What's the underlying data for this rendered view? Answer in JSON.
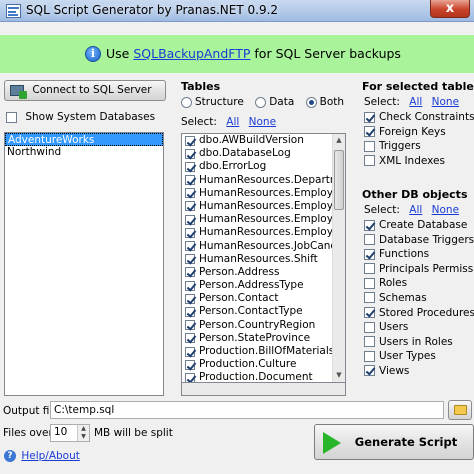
{
  "window": {
    "title": "SQL Script Generator by Pranas.NET 0.9.2",
    "close_glyph": "x"
  },
  "banner": {
    "prefix": "Use ",
    "link": "SQLBackupAndFTP",
    "suffix": " for SQL Server backups",
    "color": "#a9f39a"
  },
  "left": {
    "connect_label": "Connect to SQL Server",
    "show_system_label": "Show System Databases",
    "show_system_checked": false,
    "databases": [
      "AdventureWorks",
      "Northwind"
    ],
    "selected_database": "AdventureWorks"
  },
  "tables": {
    "title": "Tables",
    "radio_options": [
      {
        "label": "Structure",
        "checked": false
      },
      {
        "label": "Data",
        "checked": false
      },
      {
        "label": "Both",
        "checked": true
      }
    ],
    "select_label": "Select:",
    "all_label": "All",
    "none_label": "None",
    "items": [
      "dbo.AWBuildVersion",
      "dbo.DatabaseLog",
      "dbo.ErrorLog",
      "HumanResources.Department",
      "HumanResources.Employee",
      "HumanResources.EmployeeAdd",
      "HumanResources.EmployeeDep",
      "HumanResources.EmployeePay",
      "HumanResources.JobCandidate",
      "HumanResources.Shift",
      "Person.Address",
      "Person.AddressType",
      "Person.Contact",
      "Person.ContactType",
      "Person.CountryRegion",
      "Person.StateProvince",
      "Production.BillOfMaterials",
      "Production.Culture",
      "Production.Document"
    ]
  },
  "for_selected": {
    "title": "For selected tables",
    "select_label": "Select:",
    "all_label": "All",
    "none_label": "None",
    "items": [
      {
        "label": "Check Constraints",
        "checked": true
      },
      {
        "label": "Foreign Keys",
        "checked": true
      },
      {
        "label": "Triggers",
        "checked": false
      },
      {
        "label": "XML Indexes",
        "checked": false
      }
    ]
  },
  "other": {
    "title": "Other DB objects",
    "select_label": "Select:",
    "all_label": "All",
    "none_label": "None",
    "items": [
      {
        "label": "Create Database",
        "checked": true
      },
      {
        "label": "Database Triggers",
        "checked": false
      },
      {
        "label": "Functions",
        "checked": true
      },
      {
        "label": "Principals Permissions",
        "checked": false
      },
      {
        "label": "Roles",
        "checked": false
      },
      {
        "label": "Schemas",
        "checked": false
      },
      {
        "label": "Stored Procedures",
        "checked": true
      },
      {
        "label": "Users",
        "checked": false
      },
      {
        "label": "Users in Roles",
        "checked": false
      },
      {
        "label": "User Types",
        "checked": false
      },
      {
        "label": "Views",
        "checked": true
      }
    ]
  },
  "bottom": {
    "output_label": "Output file",
    "output_value": "C:\\temp.sql",
    "files_over_label": "Files over",
    "files_over_value": "10",
    "split_label": "MB will be split",
    "help_label": "Help/About",
    "generate_label": "Generate Script"
  }
}
